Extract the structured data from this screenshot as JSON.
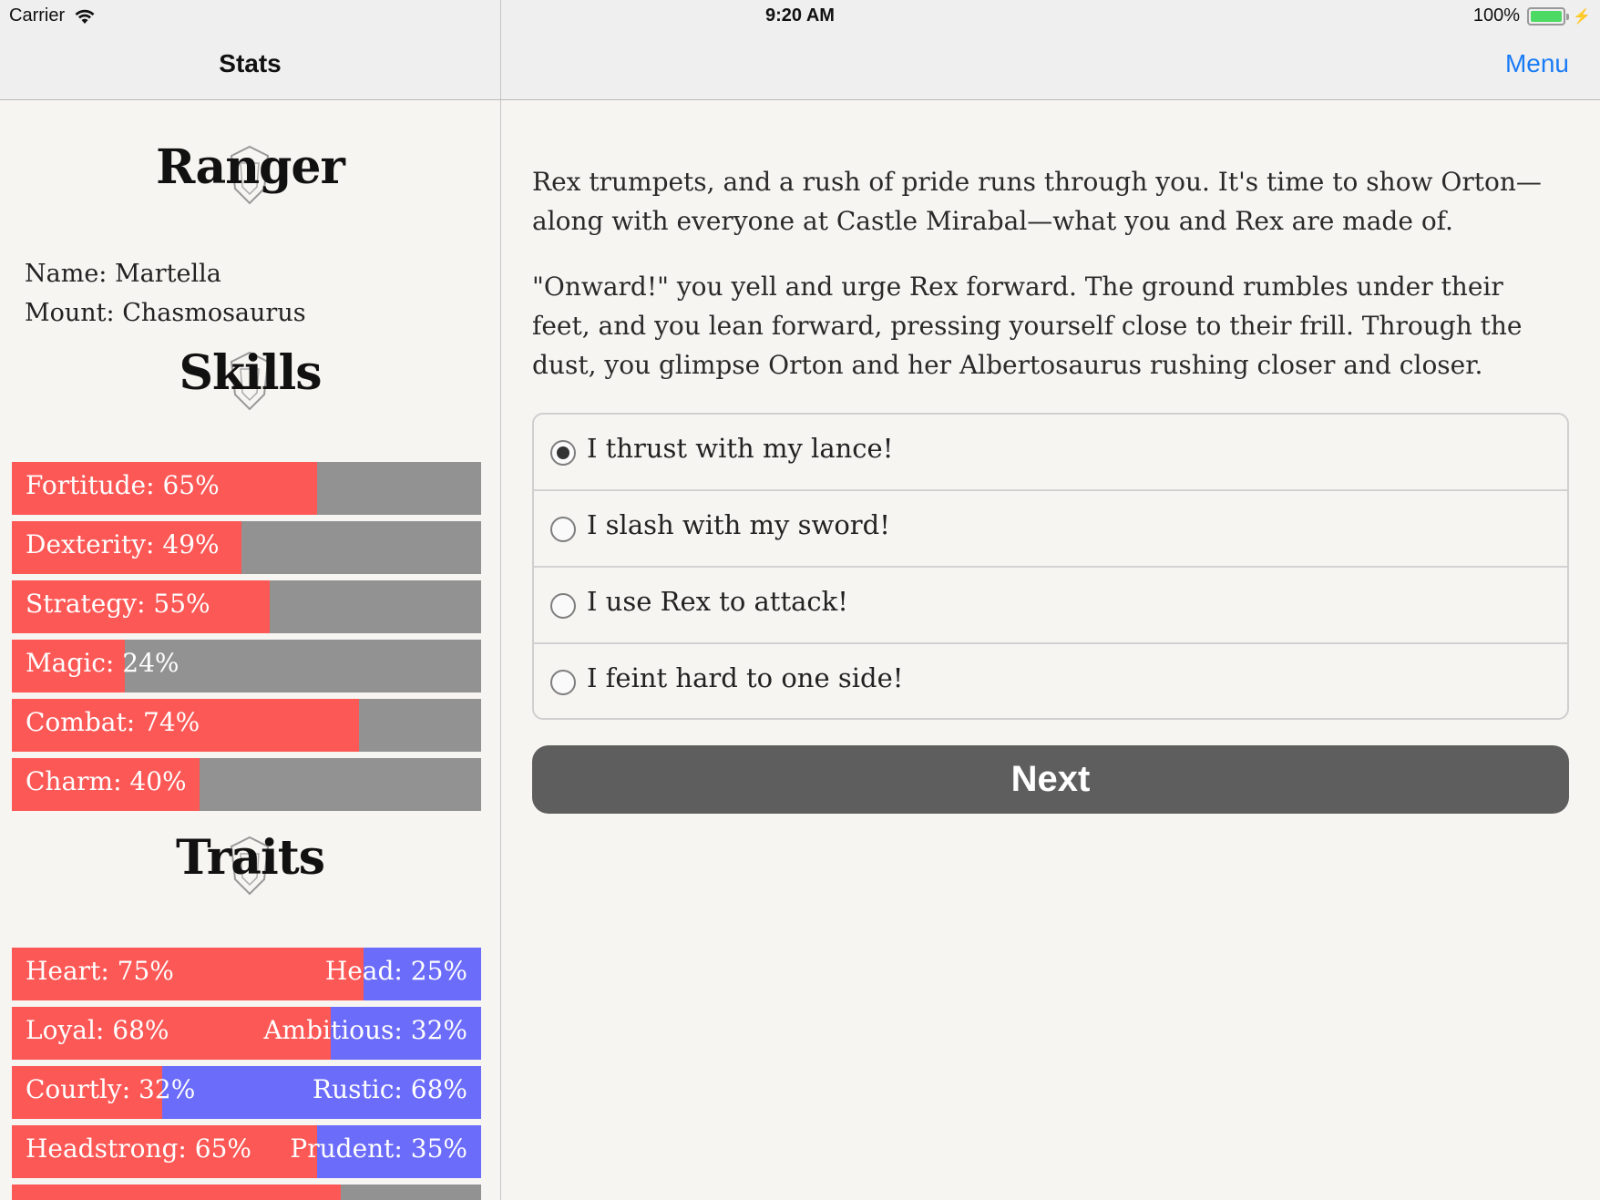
{
  "status_bar": {
    "carrier": "Carrier",
    "time": "9:20 AM",
    "battery": "100%"
  },
  "left_nav": {
    "title": "Stats"
  },
  "right_nav": {
    "menu_label": "Menu"
  },
  "stats": {
    "class_title": "Ranger",
    "name_line": "Name: Martella",
    "mount_line": "Mount: Chasmosaurus",
    "skills_title": "Skills",
    "traits_title": "Traits",
    "skills": [
      {
        "label": "Fortitude: 65%",
        "value": 65
      },
      {
        "label": "Dexterity: 49%",
        "value": 49
      },
      {
        "label": "Strategy: 55%",
        "value": 55
      },
      {
        "label": "Magic: 24%",
        "value": 24
      },
      {
        "label": "Combat: 74%",
        "value": 74
      },
      {
        "label": "Charm: 40%",
        "value": 40
      }
    ],
    "traits": [
      {
        "left_label": "Heart: 75%",
        "right_label": "Head: 25%",
        "value": 75
      },
      {
        "left_label": "Loyal: 68%",
        "right_label": "Ambitious: 32%",
        "value": 68
      },
      {
        "left_label": "Courtly: 32%",
        "right_label": "Rustic: 68%",
        "value": 32
      },
      {
        "left_label": "Headstrong: 65%",
        "right_label": "Prudent: 35%",
        "value": 65
      }
    ],
    "partial_bar_value": 70
  },
  "story": {
    "paragraphs": [
      "Rex trumpets, and a rush of pride runs through you. It's time to show Orton—along with everyone at Castle Mirabal—what you and Rex are made of.",
      "\"Onward!\" you yell and urge Rex forward. The ground rumbles under their feet, and you lean forward, pressing yourself close to their frill. Through the dust, you glimpse Orton and her Albertosaurus rushing closer and closer."
    ],
    "choices": [
      {
        "label": "I thrust with my lance!",
        "selected": true
      },
      {
        "label": "I slash with my sword!",
        "selected": false
      },
      {
        "label": "I use Rex to attack!",
        "selected": false
      },
      {
        "label": "I feint hard to one side!",
        "selected": false
      }
    ],
    "next_label": "Next"
  },
  "colors": {
    "skill_fill": "#fc5856",
    "trait_right": "#6b6cfa",
    "track": "#929292",
    "accent": "#1a7cf5",
    "next_button": "#5e5e5e"
  }
}
